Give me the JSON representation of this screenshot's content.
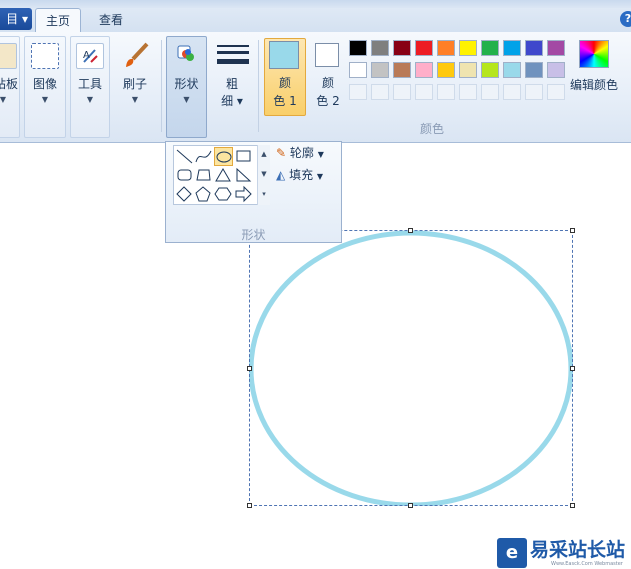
{
  "tabs": {
    "file": "目",
    "home": "主页",
    "view": "查看",
    "help": "?"
  },
  "ribbon": {
    "clipboard": "站板",
    "image": "图像",
    "tools": "工具",
    "brushes": "刷子",
    "shapes": "形状",
    "size_line1": "粗",
    "size_line2": "细",
    "color1_line1": "颜",
    "color1_line2": "色 1",
    "color2_line1": "颜",
    "color2_line2": "色 2",
    "colors_group": "颜色",
    "edit_colors": "编辑颜色"
  },
  "palette_row1": [
    "#000000",
    "#7f7f7f",
    "#880015",
    "#ed1c24",
    "#ff7f27",
    "#fff200",
    "#22b14c",
    "#00a2e8",
    "#3f48cc",
    "#a349a4"
  ],
  "palette_row2": [
    "#ffffff",
    "#c3c3c3",
    "#b97a57",
    "#ffaec9",
    "#ffc90e",
    "#efe4b0",
    "#b5e61d",
    "#99d9ea",
    "#7092be",
    "#c8bfe7"
  ],
  "color1": "#99d9ea",
  "color2": "#ffffff",
  "shapes_dropdown": {
    "title": "形状",
    "outline": "轮廓",
    "fill": "填充",
    "selected_shape": "oval"
  },
  "canvas": {
    "shape": "oval",
    "stroke_color": "#99d9ea"
  },
  "watermark": {
    "text": "易采站长站",
    "sub": "Www.Easck.Com  Webmaster",
    "logo": "e"
  }
}
